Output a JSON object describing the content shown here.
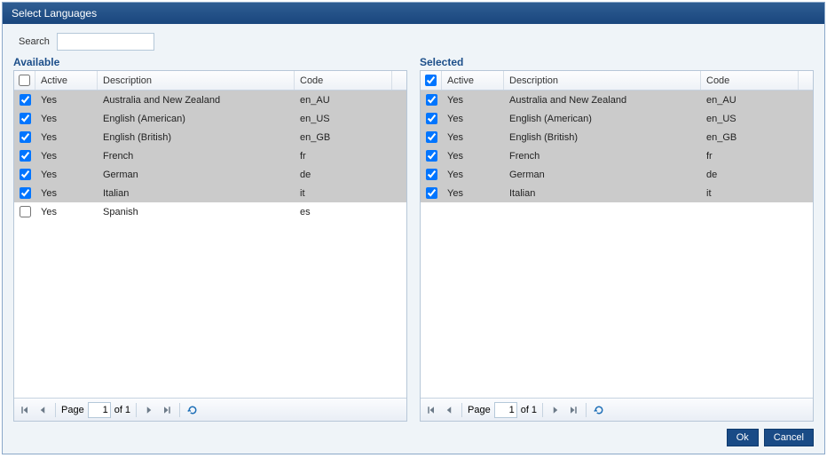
{
  "title": "Select Languages",
  "search": {
    "label": "Search",
    "value": ""
  },
  "headers": {
    "active": "Active",
    "description": "Description",
    "code": "Code"
  },
  "panels": {
    "available": {
      "title": "Available",
      "headerChecked": false,
      "rows": [
        {
          "checked": true,
          "selected": true,
          "active": "Yes",
          "desc": "Australia and New Zealand",
          "code": "en_AU"
        },
        {
          "checked": true,
          "selected": true,
          "active": "Yes",
          "desc": "English (American)",
          "code": "en_US"
        },
        {
          "checked": true,
          "selected": true,
          "active": "Yes",
          "desc": "English (British)",
          "code": "en_GB"
        },
        {
          "checked": true,
          "selected": true,
          "active": "Yes",
          "desc": "French",
          "code": "fr"
        },
        {
          "checked": true,
          "selected": true,
          "active": "Yes",
          "desc": "German",
          "code": "de"
        },
        {
          "checked": true,
          "selected": true,
          "active": "Yes",
          "desc": "Italian",
          "code": "it"
        },
        {
          "checked": false,
          "selected": false,
          "active": "Yes",
          "desc": "Spanish",
          "code": "es"
        }
      ],
      "pager": {
        "pageLabel": "Page",
        "page": "1",
        "ofLabel": "of 1"
      }
    },
    "selected": {
      "title": "Selected",
      "headerChecked": true,
      "rows": [
        {
          "checked": true,
          "selected": true,
          "active": "Yes",
          "desc": "Australia and New Zealand",
          "code": "en_AU"
        },
        {
          "checked": true,
          "selected": true,
          "active": "Yes",
          "desc": "English (American)",
          "code": "en_US"
        },
        {
          "checked": true,
          "selected": true,
          "active": "Yes",
          "desc": "English (British)",
          "code": "en_GB"
        },
        {
          "checked": true,
          "selected": true,
          "active": "Yes",
          "desc": "French",
          "code": "fr"
        },
        {
          "checked": true,
          "selected": true,
          "active": "Yes",
          "desc": "German",
          "code": "de"
        },
        {
          "checked": true,
          "selected": true,
          "active": "Yes",
          "desc": "Italian",
          "code": "it"
        }
      ],
      "pager": {
        "pageLabel": "Page",
        "page": "1",
        "ofLabel": "of 1"
      }
    }
  },
  "buttons": {
    "ok": "Ok",
    "cancel": "Cancel"
  }
}
